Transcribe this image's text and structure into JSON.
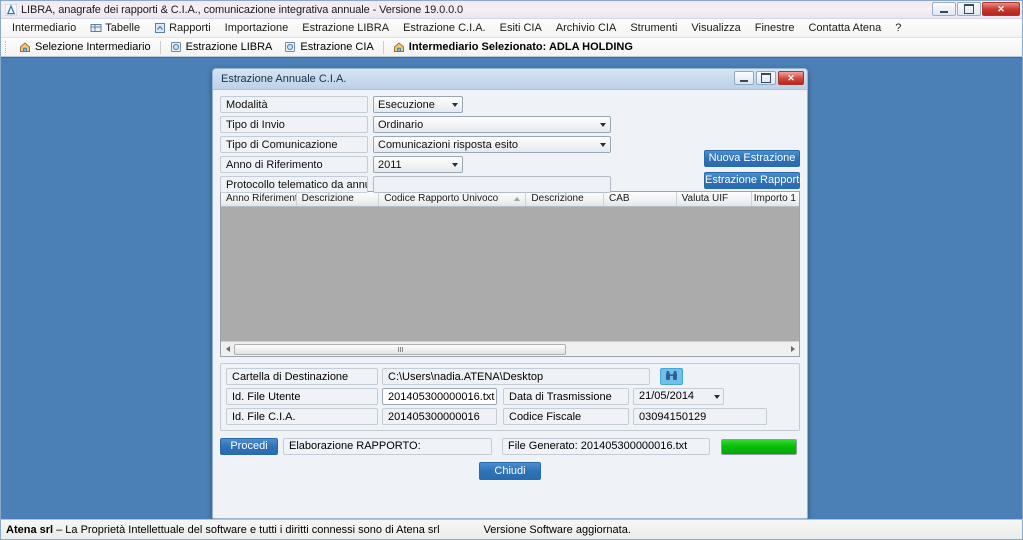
{
  "window": {
    "title": "LIBRA, anagrafe dei rapporti & C.I.A., comunicazione integrativa annuale - Versione 19.0.0.0",
    "app_icon": "libra-app-icon",
    "controls": {
      "minimize": "minimize-icon",
      "maximize": "maximize-icon",
      "close": "✕"
    }
  },
  "menubar": {
    "items": [
      {
        "label": "Intermediario",
        "icon": null
      },
      {
        "label": "Tabelle",
        "icon": "table-icon"
      },
      {
        "label": "Rapporti",
        "icon": "report-icon"
      },
      {
        "label": "Importazione",
        "icon": null
      },
      {
        "label": "Estrazione LIBRA",
        "icon": null
      },
      {
        "label": "Estrazione C.I.A.",
        "icon": null
      },
      {
        "label": "Esiti CIA",
        "icon": null
      },
      {
        "label": "Archivio CIA",
        "icon": null
      },
      {
        "label": "Strumenti",
        "icon": null
      },
      {
        "label": "Visualizza",
        "icon": null
      },
      {
        "label": "Finestre",
        "icon": null
      },
      {
        "label": "Contatta Atena",
        "icon": null
      },
      {
        "label": "?",
        "icon": null
      }
    ]
  },
  "toolbar": {
    "items": [
      {
        "label": "Selezione Intermediario",
        "icon": "house-icon",
        "bold": false
      },
      {
        "label": "Estrazione LIBRA",
        "icon": "disc-icon",
        "bold": false
      },
      {
        "label": "Estrazione CIA",
        "icon": "disc-icon",
        "bold": false
      },
      {
        "label": "Intermediario Selezionato: ADLA HOLDING",
        "icon": "house-icon",
        "bold": true
      }
    ]
  },
  "dialog": {
    "title": "Estrazione Annuale C.I.A.",
    "controls": {
      "minimize": "minimize-icon",
      "maximize": "maximize-icon",
      "close": "✕"
    },
    "form": {
      "rows": [
        {
          "label": "Modalità",
          "type": "combo",
          "value": "Esecuzione",
          "size": "sm"
        },
        {
          "label": "Tipo di Invio",
          "type": "combo",
          "value": "Ordinario",
          "size": "lg"
        },
        {
          "label": "Tipo di Comunicazione",
          "type": "combo",
          "value": "Comunicazioni risposta esito",
          "size": "lg"
        },
        {
          "label": "Anno di Riferimento",
          "type": "combo",
          "value": "2011",
          "size": "sm"
        },
        {
          "label": "Protocollo telematico da annullare",
          "type": "text",
          "value": "",
          "size": "lg"
        }
      ],
      "side_buttons": [
        {
          "label": "Nuova Estrazione"
        },
        {
          "label": "Estrazione Rapporti"
        }
      ]
    },
    "grid": {
      "columns": [
        {
          "label": "Anno Riferimento",
          "width": 76,
          "sorted": false
        },
        {
          "label": "Descrizione",
          "width": 83,
          "sorted": false
        },
        {
          "label": "Codice Rapporto Univoco",
          "width": 148,
          "sorted": true
        },
        {
          "label": "Descrizione",
          "width": 78,
          "sorted": false
        },
        {
          "label": "CAB",
          "width": 73,
          "sorted": false
        },
        {
          "label": "Valuta UIF",
          "width": 76,
          "sorted": false
        },
        {
          "label": "Importo 1",
          "width": 47,
          "sorted": false
        }
      ],
      "rows": []
    },
    "destination": {
      "folder_label": "Cartella di Destinazione",
      "folder_value": "C:\\Users\\nadia.ATENA\\Desktop",
      "browse_icon": "binoculars-icon",
      "file_user_label": "Id. File Utente",
      "file_user_value": "201405300000016.txt",
      "transmission_date_label": "Data di Trasmissione",
      "transmission_date_value": "21/05/2014",
      "file_cia_label": "Id. File C.I.A.",
      "file_cia_value": "201405300000016",
      "fiscal_code_label": "Codice Fiscale",
      "fiscal_code_value": "03094150129"
    },
    "actions": {
      "proceed_label": "Procedi",
      "processing_status": "Elaborazione RAPPORTO:",
      "generated_file": "File Generato: 201405300000016.txt",
      "progress_percent": 100,
      "progress_color": "#0abf0a",
      "close_label": "Chiudi"
    }
  },
  "statusbar": {
    "copyright_strong": "Atena srl",
    "copyright_rest": "  – La Proprietà Intellettuale del software e tutti i diritti connessi sono di Atena srl",
    "version_note": "Versione Software aggiornata."
  },
  "colors": {
    "mdi_background": "#4a80b5",
    "accent_blue": "#2f72b8",
    "grid_body": "#ababab",
    "progress_green": "#0abf0a",
    "browse_icon_bg": "#6ec1ea"
  }
}
